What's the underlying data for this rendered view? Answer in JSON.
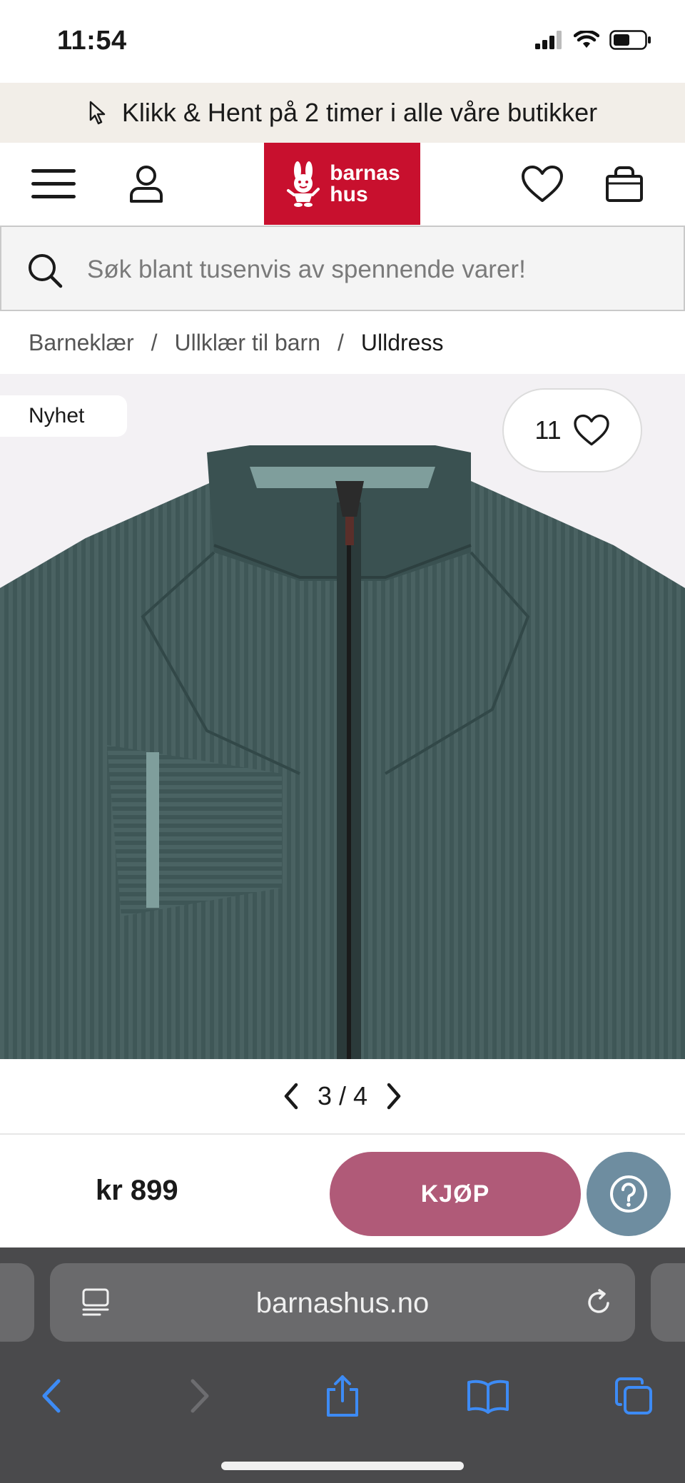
{
  "status_bar": {
    "time": "11:54"
  },
  "promo": {
    "text": "Klikk & Hent på 2 timer i alle våre butikker",
    "icon": "cursor-icon"
  },
  "header": {
    "menu_icon": "hamburger-menu-icon",
    "account_icon": "user-icon",
    "logo_text_line1": "barnas",
    "logo_text_line2": "hus",
    "favorites_icon": "heart-icon",
    "cart_icon": "shopping-bag-icon",
    "brand_color": "#c8102e"
  },
  "search": {
    "placeholder": "Søk blant tusenvis av spennende varer!"
  },
  "breadcrumb": {
    "items": [
      "Barneklær",
      "Ullklær til barn",
      "Ulldress"
    ],
    "separator": "/"
  },
  "product": {
    "badge": "Nyhet",
    "favorite_count": "11",
    "image_position": "3 / 4",
    "price": "kr 899",
    "buy_label": "KJØP",
    "buy_color": "#b05a78",
    "help_color": "#6e8da0"
  },
  "browser": {
    "url": "barnashus.no"
  }
}
